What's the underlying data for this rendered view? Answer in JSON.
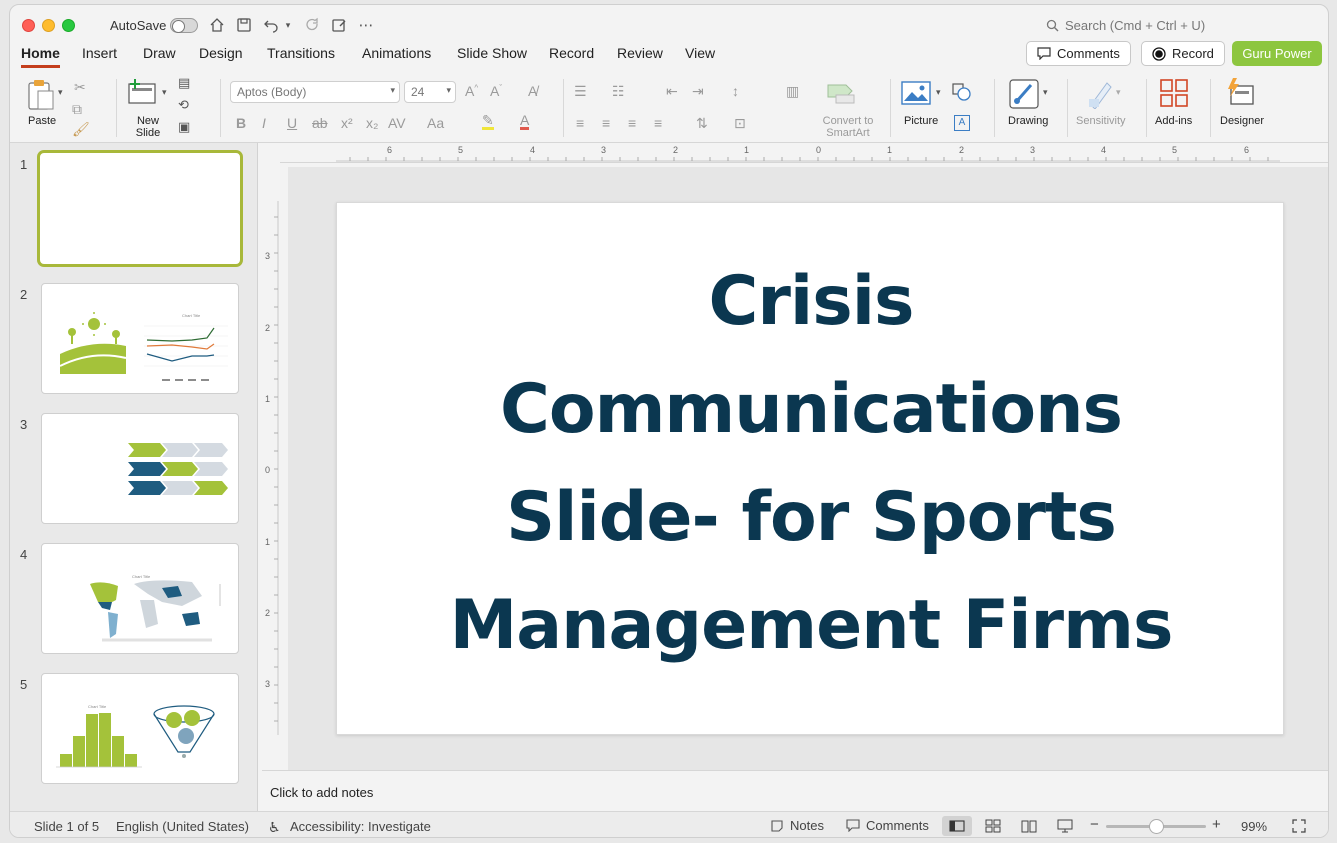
{
  "titlebar": {
    "autosave_label": "AutoSave",
    "search_placeholder": "Search (Cmd + Ctrl + U)"
  },
  "menu": {
    "tabs": [
      "Home",
      "Insert",
      "Draw",
      "Design",
      "Transitions",
      "Animations",
      "Slide Show",
      "Record",
      "Review",
      "View"
    ],
    "comments_btn": "Comments",
    "record_btn": "Record",
    "guru_btn": "Guru Power"
  },
  "ribbon": {
    "paste": "Paste",
    "new_slide_1": "New",
    "new_slide_2": "Slide",
    "font_name": "Aptos (Body)",
    "font_size": "24",
    "convert_1": "Convert to",
    "convert_2": "SmartArt",
    "picture": "Picture",
    "drawing": "Drawing",
    "sensitivity": "Sensitivity",
    "addins": "Add-ins",
    "designer": "Designer"
  },
  "thumbnails": {
    "numbers": [
      "1",
      "2",
      "3",
      "4",
      "5"
    ],
    "chart_title": "Chart Title"
  },
  "ruler": {
    "h_labels": [
      "6",
      "5",
      "4",
      "3",
      "2",
      "1",
      "0",
      "1",
      "2",
      "3",
      "4",
      "5",
      "6"
    ],
    "v_labels": [
      "3",
      "2",
      "1",
      "0",
      "1",
      "2",
      "3"
    ]
  },
  "slide": {
    "title_lines": [
      "Crisis",
      "Communications",
      "Slide- for Sports",
      "Management Firms"
    ]
  },
  "notes": {
    "placeholder": "Click to add notes"
  },
  "status": {
    "slide_count": "Slide 1 of 5",
    "language": "English (United States)",
    "accessibility": "Accessibility: Investigate",
    "notes": "Notes",
    "comments": "Comments",
    "zoom": "99%"
  },
  "colors": {
    "accent_tab": "#c43e1c",
    "guru_green": "#8dc63f",
    "title_navy": "#0b3750",
    "thumb_green": "#a4c23a",
    "thumb_blue": "#1f5c80"
  }
}
